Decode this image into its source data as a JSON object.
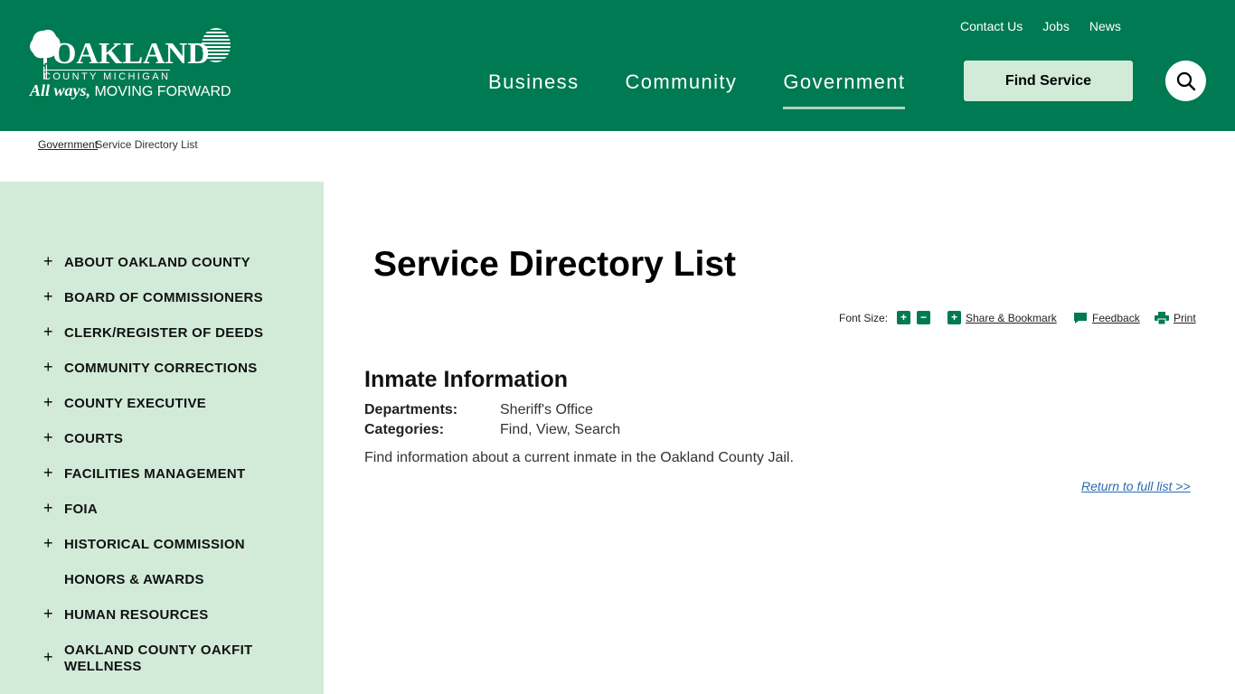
{
  "header": {
    "logo": {
      "name": "OAKLAND",
      "subtitle": "COUNTY MICHIGAN",
      "tagline_script": "All ways,",
      "tagline": "MOVING FORWARD"
    },
    "utility_links": [
      "Contact Us",
      "Jobs",
      "News"
    ],
    "nav": [
      {
        "label": "Business",
        "active": false
      },
      {
        "label": "Community",
        "active": false
      },
      {
        "label": "Government",
        "active": true
      }
    ],
    "find_service_label": "Find Service",
    "search_icon": "search-icon",
    "colors": {
      "brand_green": "#007a52",
      "light_green": "#d2ebd9",
      "nav_underline": "#a9d6bd"
    }
  },
  "breadcrumb": {
    "parent": "Government",
    "current": "Service Directory List"
  },
  "sidebar": {
    "items": [
      {
        "label": "ABOUT OAKLAND COUNTY",
        "expandable": true
      },
      {
        "label": "BOARD OF COMMISSIONERS",
        "expandable": true
      },
      {
        "label": "CLERK/REGISTER OF DEEDS",
        "expandable": true
      },
      {
        "label": "COMMUNITY CORRECTIONS",
        "expandable": true
      },
      {
        "label": "COUNTY EXECUTIVE",
        "expandable": true
      },
      {
        "label": "COURTS",
        "expandable": true
      },
      {
        "label": "FACILITIES MANAGEMENT",
        "expandable": true
      },
      {
        "label": "FOIA",
        "expandable": true
      },
      {
        "label": "HISTORICAL COMMISSION",
        "expandable": true
      },
      {
        "label": "HONORS & AWARDS",
        "expandable": false
      },
      {
        "label": "HUMAN RESOURCES",
        "expandable": true
      },
      {
        "label": "OAKLAND COUNTY OAKFIT WELLNESS",
        "expandable": true
      }
    ]
  },
  "main": {
    "title": "Service Directory List",
    "tools": {
      "font_size_label": "Font Size:",
      "increase": "+",
      "decrease": "−",
      "share_label": "Share & Bookmark",
      "feedback_label": "Feedback",
      "print_label": "Print"
    },
    "entry": {
      "title": "Inmate Information",
      "departments_label": "Departments:",
      "departments_value": "Sheriff's Office",
      "categories_label": "Categories:",
      "categories_value": "Find, View, Search",
      "description": "Find information about a current inmate in the Oakland County Jail.",
      "return_link": "Return to full list >>"
    }
  }
}
